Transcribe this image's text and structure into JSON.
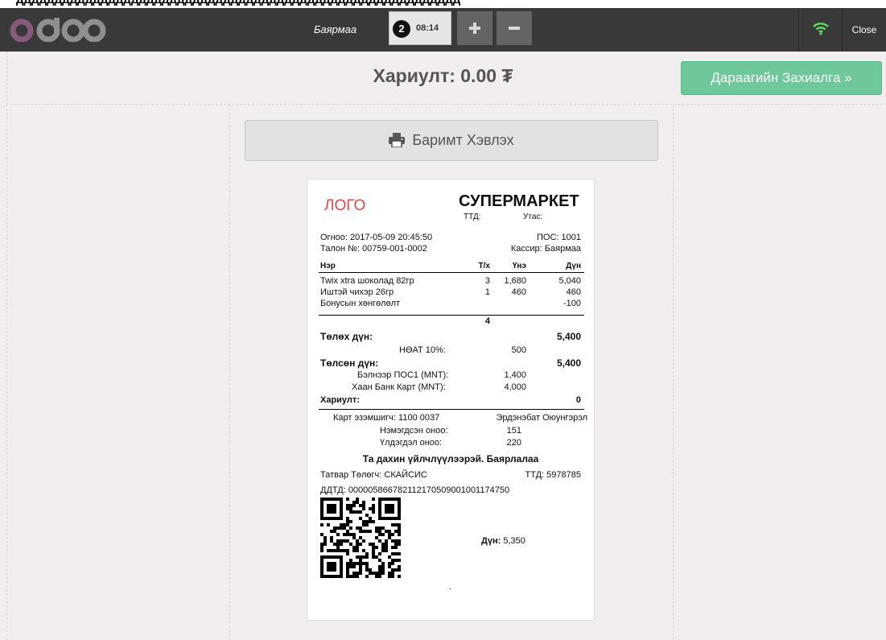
{
  "page_top_text": "дддддддддддддддддддддддддддддддддддддддддддддддддддддддддд",
  "topbar": {
    "logo_text": "odoo",
    "cashier": "Баярмаа",
    "order_number": "2",
    "order_time": "08:14",
    "close_label": "Close"
  },
  "payment": {
    "change_label": "Хариулт: 0.00 ₮",
    "next_order_label": "Дараагийн Захиалга",
    "print_receipt_label": "Баримт Хэвлэх"
  },
  "receipt": {
    "logo": "ЛОГО",
    "store_name": "СУПЕРМАРКЕТ",
    "ttd_label": "ТТД:",
    "phone_label": "Утас:",
    "date": "Огноо: 2017-05-09 20:45:50",
    "pos": "ПОС: 1001",
    "ticket": "Талон №: 00759-001-0002",
    "cashier": "Кассир: Баярмаа",
    "columns": [
      "Нэр",
      "Т/х",
      "Үнэ",
      "Дүн"
    ],
    "lines": [
      {
        "name": "Twix xtra шоколад 82гр",
        "qty": "3",
        "price": "1,680",
        "total": "5,040"
      },
      {
        "name": "Иштэй чихэр 26гр",
        "qty": "1",
        "price": "460",
        "total": "460"
      },
      {
        "name": "Бонусын хөнгөлөлт",
        "qty": "",
        "price": "",
        "total": "-100"
      }
    ],
    "total_qty": "4",
    "amount_due_label": "Төлөх дүн:",
    "amount_due": "5,400",
    "vat_label": "НӨАТ 10%:",
    "vat": "500",
    "paid_label": "Төлсөн дүн:",
    "paid": "5,400",
    "payments": [
      {
        "label": "Бэлнээр ПОС1 (MNT):",
        "amount": "1,400"
      },
      {
        "label": "Хаан Банк Карт (MNT):",
        "amount": "4,000"
      }
    ],
    "change_label": "Хариулт:",
    "change": "0",
    "card_holder_label": "Карт эзэмшигч: 1100 0037",
    "card_holder_name": "Эрдэнэбат Оюунгэрэл",
    "added_points_label": "Нэмэгдсэн оноо:",
    "added_points": "151",
    "remaining_points_label": "Үлдэгдэл оноо:",
    "remaining_points": "220",
    "thanks": "Та дахин үйлчлүүлээрэй. Баярлалаа",
    "taxpayer": "Татвар Төлөгч: СКАЙСИС",
    "taxpayer_ttd": "ТТД: 5978785",
    "ddtd": "ДДТД: 000005866782112170509001001174750",
    "qr_total_label": "Дүн:",
    "qr_total": "5,350",
    "footer_dot": "."
  },
  "colors": {
    "topbar_bg": "#393939",
    "next_button": "#6ec89b",
    "logo_red": "#e04a4a",
    "odoo_purple": "#875A7B",
    "wifi_green": "#5cd65c"
  },
  "icons": [
    "odoo-logo",
    "plus-icon",
    "minus-icon",
    "wifi-icon",
    "printer-icon",
    "double-chevron-right-icon",
    "qr-code"
  ]
}
